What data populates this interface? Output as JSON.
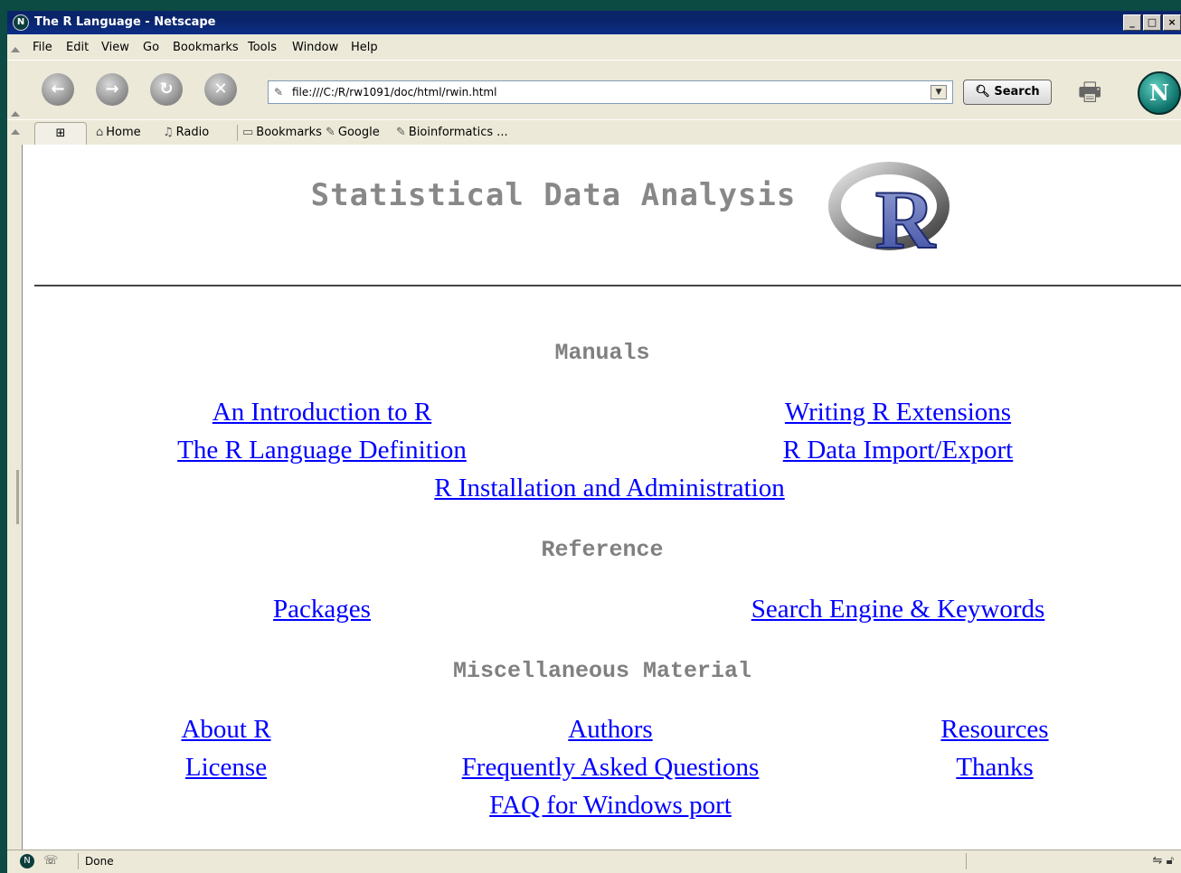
{
  "window": {
    "title": "The R Language - Netscape",
    "controls": {
      "minimize": "_",
      "maximize": "□",
      "close": "×"
    }
  },
  "menu": [
    "File",
    "Edit",
    "View",
    "Go",
    "Bookmarks",
    "Tools",
    "Window",
    "Help"
  ],
  "navigation": {
    "url": "file:///C:/R/rw1091/doc/html/rwin.html",
    "search_label": "Search",
    "logo_letter": "N"
  },
  "personal_toolbar": {
    "items": [
      {
        "label": "Home",
        "icon": "home-icon"
      },
      {
        "label": "Radio",
        "icon": "radio-icon"
      },
      {
        "label": "Bookmarks",
        "icon": "bookmarks-folder-icon"
      },
      {
        "label": "Google",
        "icon": "bookmark-link-icon"
      },
      {
        "label": "Bioinformatics ...",
        "icon": "bookmark-link-icon"
      }
    ]
  },
  "page": {
    "title": "Statistical Data Analysis",
    "logo_letter": "R",
    "sections": {
      "manuals": {
        "heading": "Manuals",
        "links": [
          "An Introduction to R",
          "Writing R Extensions",
          "The R Language Definition",
          "R Data Import/Export",
          "R Installation and Administration"
        ]
      },
      "reference": {
        "heading": "Reference",
        "links": [
          "Packages",
          "Search Engine & Keywords"
        ]
      },
      "misc": {
        "heading": "Miscellaneous Material",
        "links": [
          "About R",
          "Authors",
          "Resources",
          "License",
          "Frequently Asked Questions",
          "Thanks",
          "FAQ for Windows port"
        ]
      }
    },
    "colors": {
      "link": "#0000ff",
      "heading": "#808080"
    }
  },
  "status": {
    "text": "Done"
  }
}
